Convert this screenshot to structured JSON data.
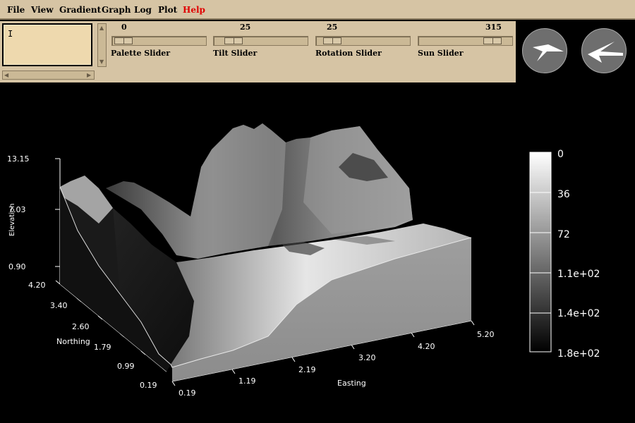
{
  "menu": {
    "items": [
      "File",
      "View",
      "Gradient",
      "Graph",
      "Log",
      "Plot",
      "Help"
    ]
  },
  "textbox": {
    "value": "I"
  },
  "sliders": [
    {
      "label": "Palette Slider",
      "value": "0",
      "fraction": 0.0
    },
    {
      "label": "Tilt Slider",
      "value": "25",
      "fraction": 0.12
    },
    {
      "label": "Rotation Slider",
      "value": "25",
      "fraction": 0.07
    },
    {
      "label": "Sun Slider",
      "value": "315",
      "fraction": 0.88
    }
  ],
  "view_buttons": [
    "rotate-left-arrow-icon",
    "rotate-right-arrow-icon"
  ],
  "plot": {
    "ylabel": "Elevation",
    "xlabel": "Easting",
    "zlabel": "Northing",
    "elevation_ticks": [
      "13.15",
      "7.03",
      "0.90"
    ],
    "northing_ticks": [
      "4.20",
      "3.40",
      "2.60",
      "1.79",
      "0.99",
      "0.19"
    ],
    "easting_ticks": [
      "0.19",
      "1.19",
      "2.19",
      "3.20",
      "4.20",
      "5.20"
    ]
  },
  "colorbar": {
    "labels": [
      "0",
      "36",
      "72",
      "1.1e+02",
      "1.4e+02",
      "1.8e+02"
    ]
  }
}
